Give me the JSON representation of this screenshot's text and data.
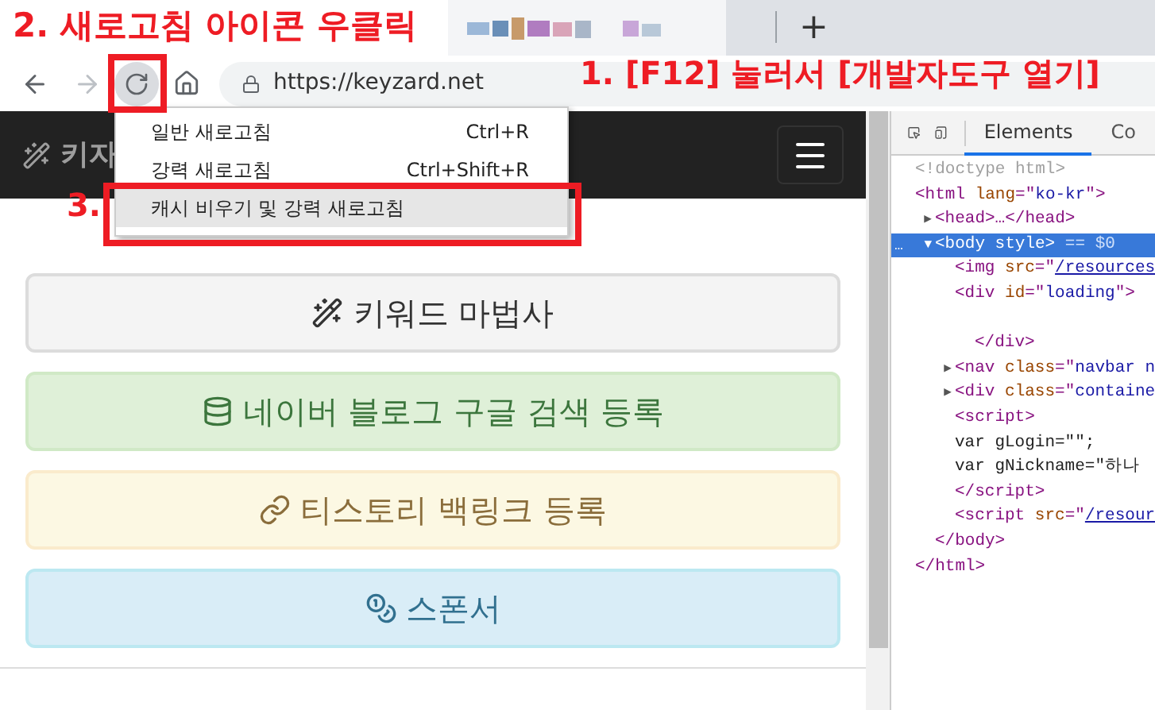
{
  "annotations": [
    {
      "text": "2. 새로고침 아이콘 우클릭"
    },
    {
      "text": "1. [F12] 눌러서 [개발자도구 열기]"
    },
    {
      "text": "3."
    }
  ],
  "browser": {
    "new_tab": "+",
    "url": "https://keyzard.net"
  },
  "context_menu": {
    "items": [
      {
        "label": "일반 새로고침",
        "shortcut": "Ctrl+R",
        "selected": false
      },
      {
        "label": "강력 새로고침",
        "shortcut": "Ctrl+Shift+R",
        "selected": false
      },
      {
        "label": "캐시 비우기 및 강력 새로고침",
        "selected": true
      }
    ]
  },
  "page": {
    "brand": "키자",
    "buttons": [
      {
        "label": "키워드 마법사"
      },
      {
        "label": "네이버 블로그 구글 검색 등록"
      },
      {
        "label": "티스토리 백링크 등록"
      },
      {
        "label": "스폰서"
      }
    ]
  },
  "devtools": {
    "tabs": [
      {
        "label": "Elements",
        "selected": true
      },
      {
        "label": "Co",
        "selected": false
      }
    ],
    "tree": [
      {
        "parts": [
          {
            "kind": "muted",
            "text": "<!doctype html>"
          }
        ]
      },
      {
        "parts": [
          {
            "kind": "tag",
            "text": "<html "
          },
          {
            "kind": "attr",
            "text": "lang"
          },
          {
            "kind": "tag",
            "text": "=\""
          },
          {
            "kind": "value",
            "text": "ko-kr"
          },
          {
            "kind": "tag",
            "text": "\">"
          }
        ],
        "children": [
          {
            "arrow": "▶",
            "parts": [
              {
                "kind": "tag",
                "text": "<head>…</head>"
              }
            ]
          },
          {
            "arrow": "▼",
            "gutter": "…",
            "selected": true,
            "parts": [
              {
                "kind": "tag",
                "text": "<body style>"
              },
              {
                "kind": "muted",
                "text": " == $0"
              }
            ],
            "children": [
              {
                "parts": [
                  {
                    "kind": "tag",
                    "text": "<img "
                  },
                  {
                    "kind": "attr",
                    "text": "src"
                  },
                  {
                    "kind": "tag",
                    "text": "=\""
                  },
                  {
                    "kind": "link",
                    "text": "/resources"
                  }
                ]
              },
              {
                "parts": [
                  {
                    "kind": "tag",
                    "text": "<div "
                  },
                  {
                    "kind": "attr",
                    "text": "id"
                  },
                  {
                    "kind": "tag",
                    "text": "=\""
                  },
                  {
                    "kind": "value",
                    "text": "loading"
                  },
                  {
                    "kind": "tag",
                    "text": "\">"
                  }
                ],
                "children": [
                  {
                    "parts": [
                      {
                        "kind": "tag",
                        "text": "</div>"
                      }
                    ]
                  }
                ]
              },
              {
                "arrow": "▶",
                "parts": [
                  {
                    "kind": "tag",
                    "text": "<nav "
                  },
                  {
                    "kind": "attr",
                    "text": "class"
                  },
                  {
                    "kind": "tag",
                    "text": "=\""
                  },
                  {
                    "kind": "value",
                    "text": "navbar n"
                  }
                ]
              },
              {
                "arrow": "▶",
                "parts": [
                  {
                    "kind": "tag",
                    "text": "<div "
                  },
                  {
                    "kind": "attr",
                    "text": "class"
                  },
                  {
                    "kind": "tag",
                    "text": "=\""
                  },
                  {
                    "kind": "value",
                    "text": "containe"
                  }
                ]
              },
              {
                "parts": [
                  {
                    "kind": "tag",
                    "text": "<script>"
                  }
                ]
              },
              {
                "parts": [
                  {
                    "kind": "text",
                    "text": "var gLogin=\"\";"
                  }
                ]
              },
              {
                "parts": [
                  {
                    "kind": "text",
                    "text": "var gNickname=\"하나"
                  }
                ]
              },
              {
                "parts": [
                  {
                    "kind": "tag",
                    "text": "</script>"
                  }
                ]
              },
              {
                "parts": [
                  {
                    "kind": "tag",
                    "text": "<script "
                  },
                  {
                    "kind": "attr",
                    "text": "src"
                  },
                  {
                    "kind": "tag",
                    "text": "=\""
                  },
                  {
                    "kind": "link",
                    "text": "/resour"
                  }
                ]
              }
            ]
          },
          {
            "parts": [
              {
                "kind": "tag",
                "text": "</body>"
              }
            ]
          }
        ]
      },
      {
        "parts": [
          {
            "kind": "tag",
            "text": "</html>"
          }
        ]
      }
    ]
  }
}
